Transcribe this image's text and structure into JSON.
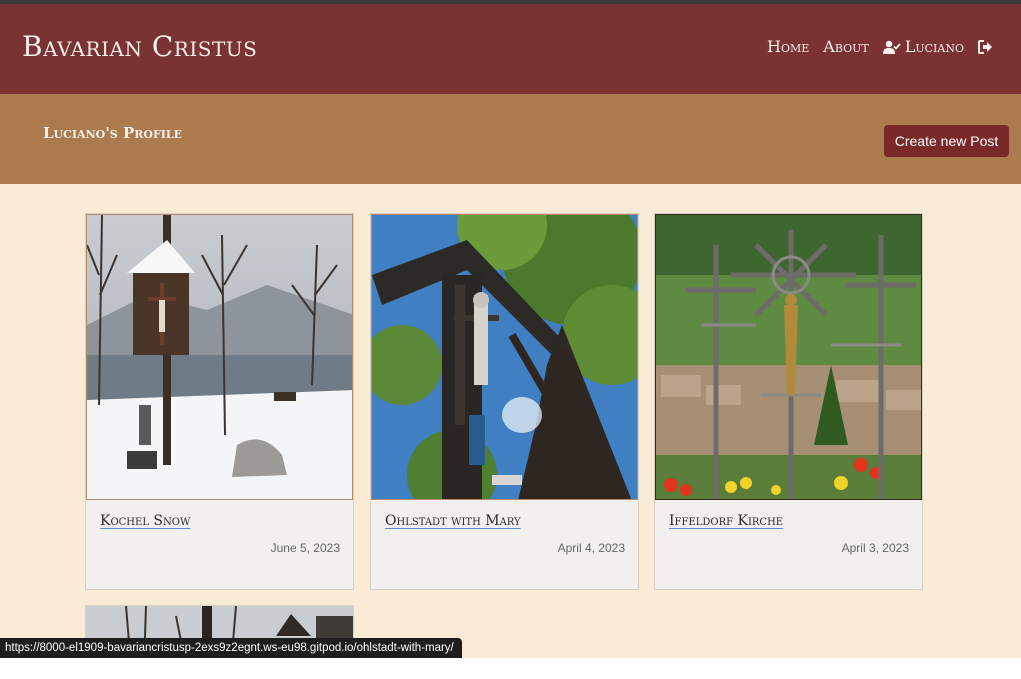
{
  "navbar": {
    "brand": "Bavarian Cristus",
    "links": [
      {
        "label": "Home"
      },
      {
        "label": "About"
      },
      {
        "label": "Luciano",
        "icon": "user-check-icon"
      },
      {
        "label": "",
        "icon": "sign-out-icon"
      }
    ]
  },
  "profile": {
    "title": "Luciano's Profile",
    "create_button": "Create new Post"
  },
  "posts": [
    {
      "title": "Kochel Snow",
      "date": "June 5, 2023"
    },
    {
      "title": "Ohlstadt with Mary",
      "date": "April 4, 2023"
    },
    {
      "title": "Iffeldorf Kirche",
      "date": "April 3, 2023"
    }
  ],
  "status_bar": {
    "url": "https://8000-el1909-bavariancristusp-2exs9z2egnt.ws-eu98.gitpod.io/ohlstadt-with-mary/"
  },
  "colors": {
    "navbar_bg": "#7a3232",
    "profile_band_bg": "#ac7b4d",
    "content_bg": "#faebd7",
    "button_bg": "#7a2828"
  }
}
